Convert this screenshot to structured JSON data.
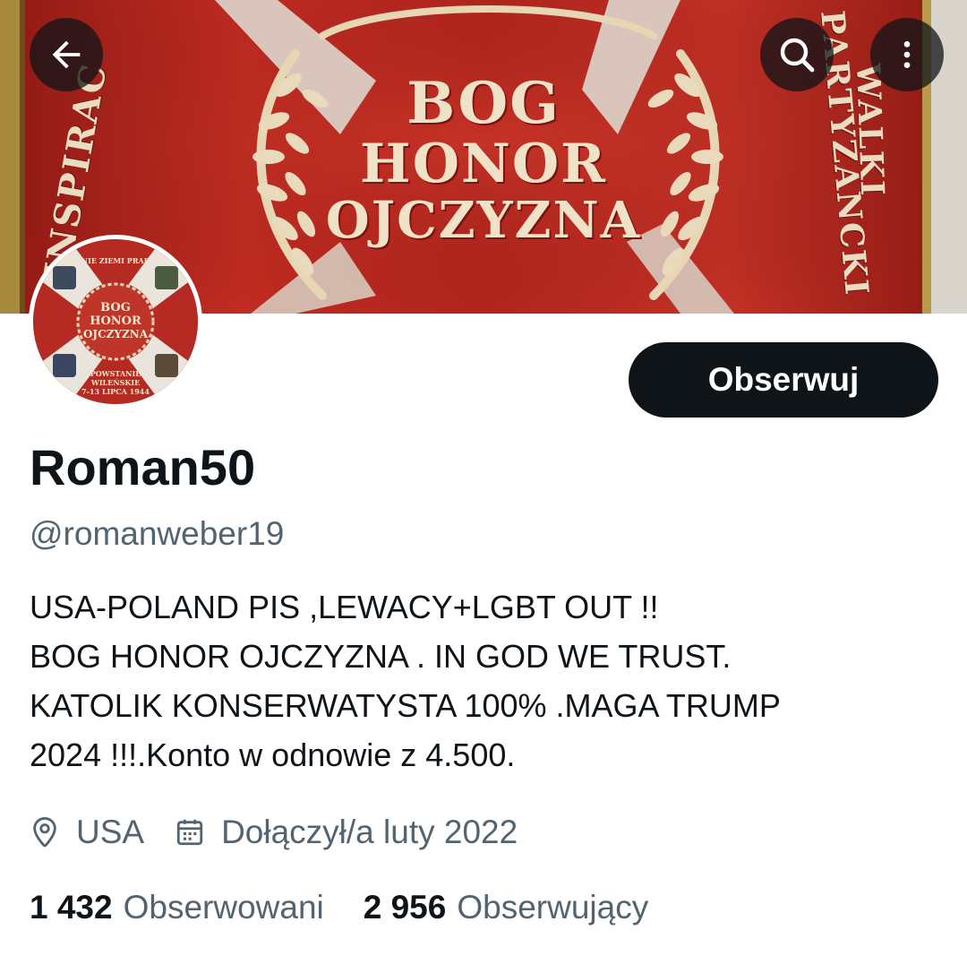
{
  "banner": {
    "motto_lines": [
      "BOG",
      "HONOR",
      "OJCZYZNA"
    ],
    "left_text": "INSPIRAC",
    "right_text_1": "WALKI",
    "right_text_2": "PARTYZANCKI",
    "colors": {
      "flag_red": "#b3261e",
      "embroidery": "#efe2c6"
    }
  },
  "nav": {
    "back_icon": "arrow-left-icon",
    "search_icon": "search-icon",
    "more_icon": "more-vertical-icon"
  },
  "avatar": {
    "top_text": "W OBRONIE ZIEMI PRADZIADÓW",
    "motto_lines": [
      "BOG",
      "HONOR",
      "OJCZYZNA"
    ],
    "bottom_lines": [
      "POWSTANIE",
      "WILEŃSKIE",
      "7-13 LIPCA 1944"
    ]
  },
  "profile": {
    "follow_label": "Obserwuj",
    "display_name": "Roman50",
    "handle": "@romanweber19",
    "bio_lines": [
      "USA-POLAND PIS ,LEWACY+LGBT OUT !!",
      "BOG HONOR OJCZYZNA . IN GOD WE TRUST.",
      "KATOLIK KONSERWATYSTA 100% .MAGA TRUMP",
      "2024 !!!.Konto w odnowie z 4.500."
    ],
    "location": "USA",
    "location_icon": "location-pin-icon",
    "joined": "Dołączył/a luty 2022",
    "joined_icon": "calendar-icon",
    "following_count": "1 432",
    "following_label": "Obserwowani",
    "followers_count": "2 956",
    "followers_label": "Obserwujący"
  },
  "colors": {
    "text_primary": "#0f1419",
    "text_secondary": "#536471",
    "button_bg": "#0f1419",
    "button_text": "#ffffff"
  }
}
